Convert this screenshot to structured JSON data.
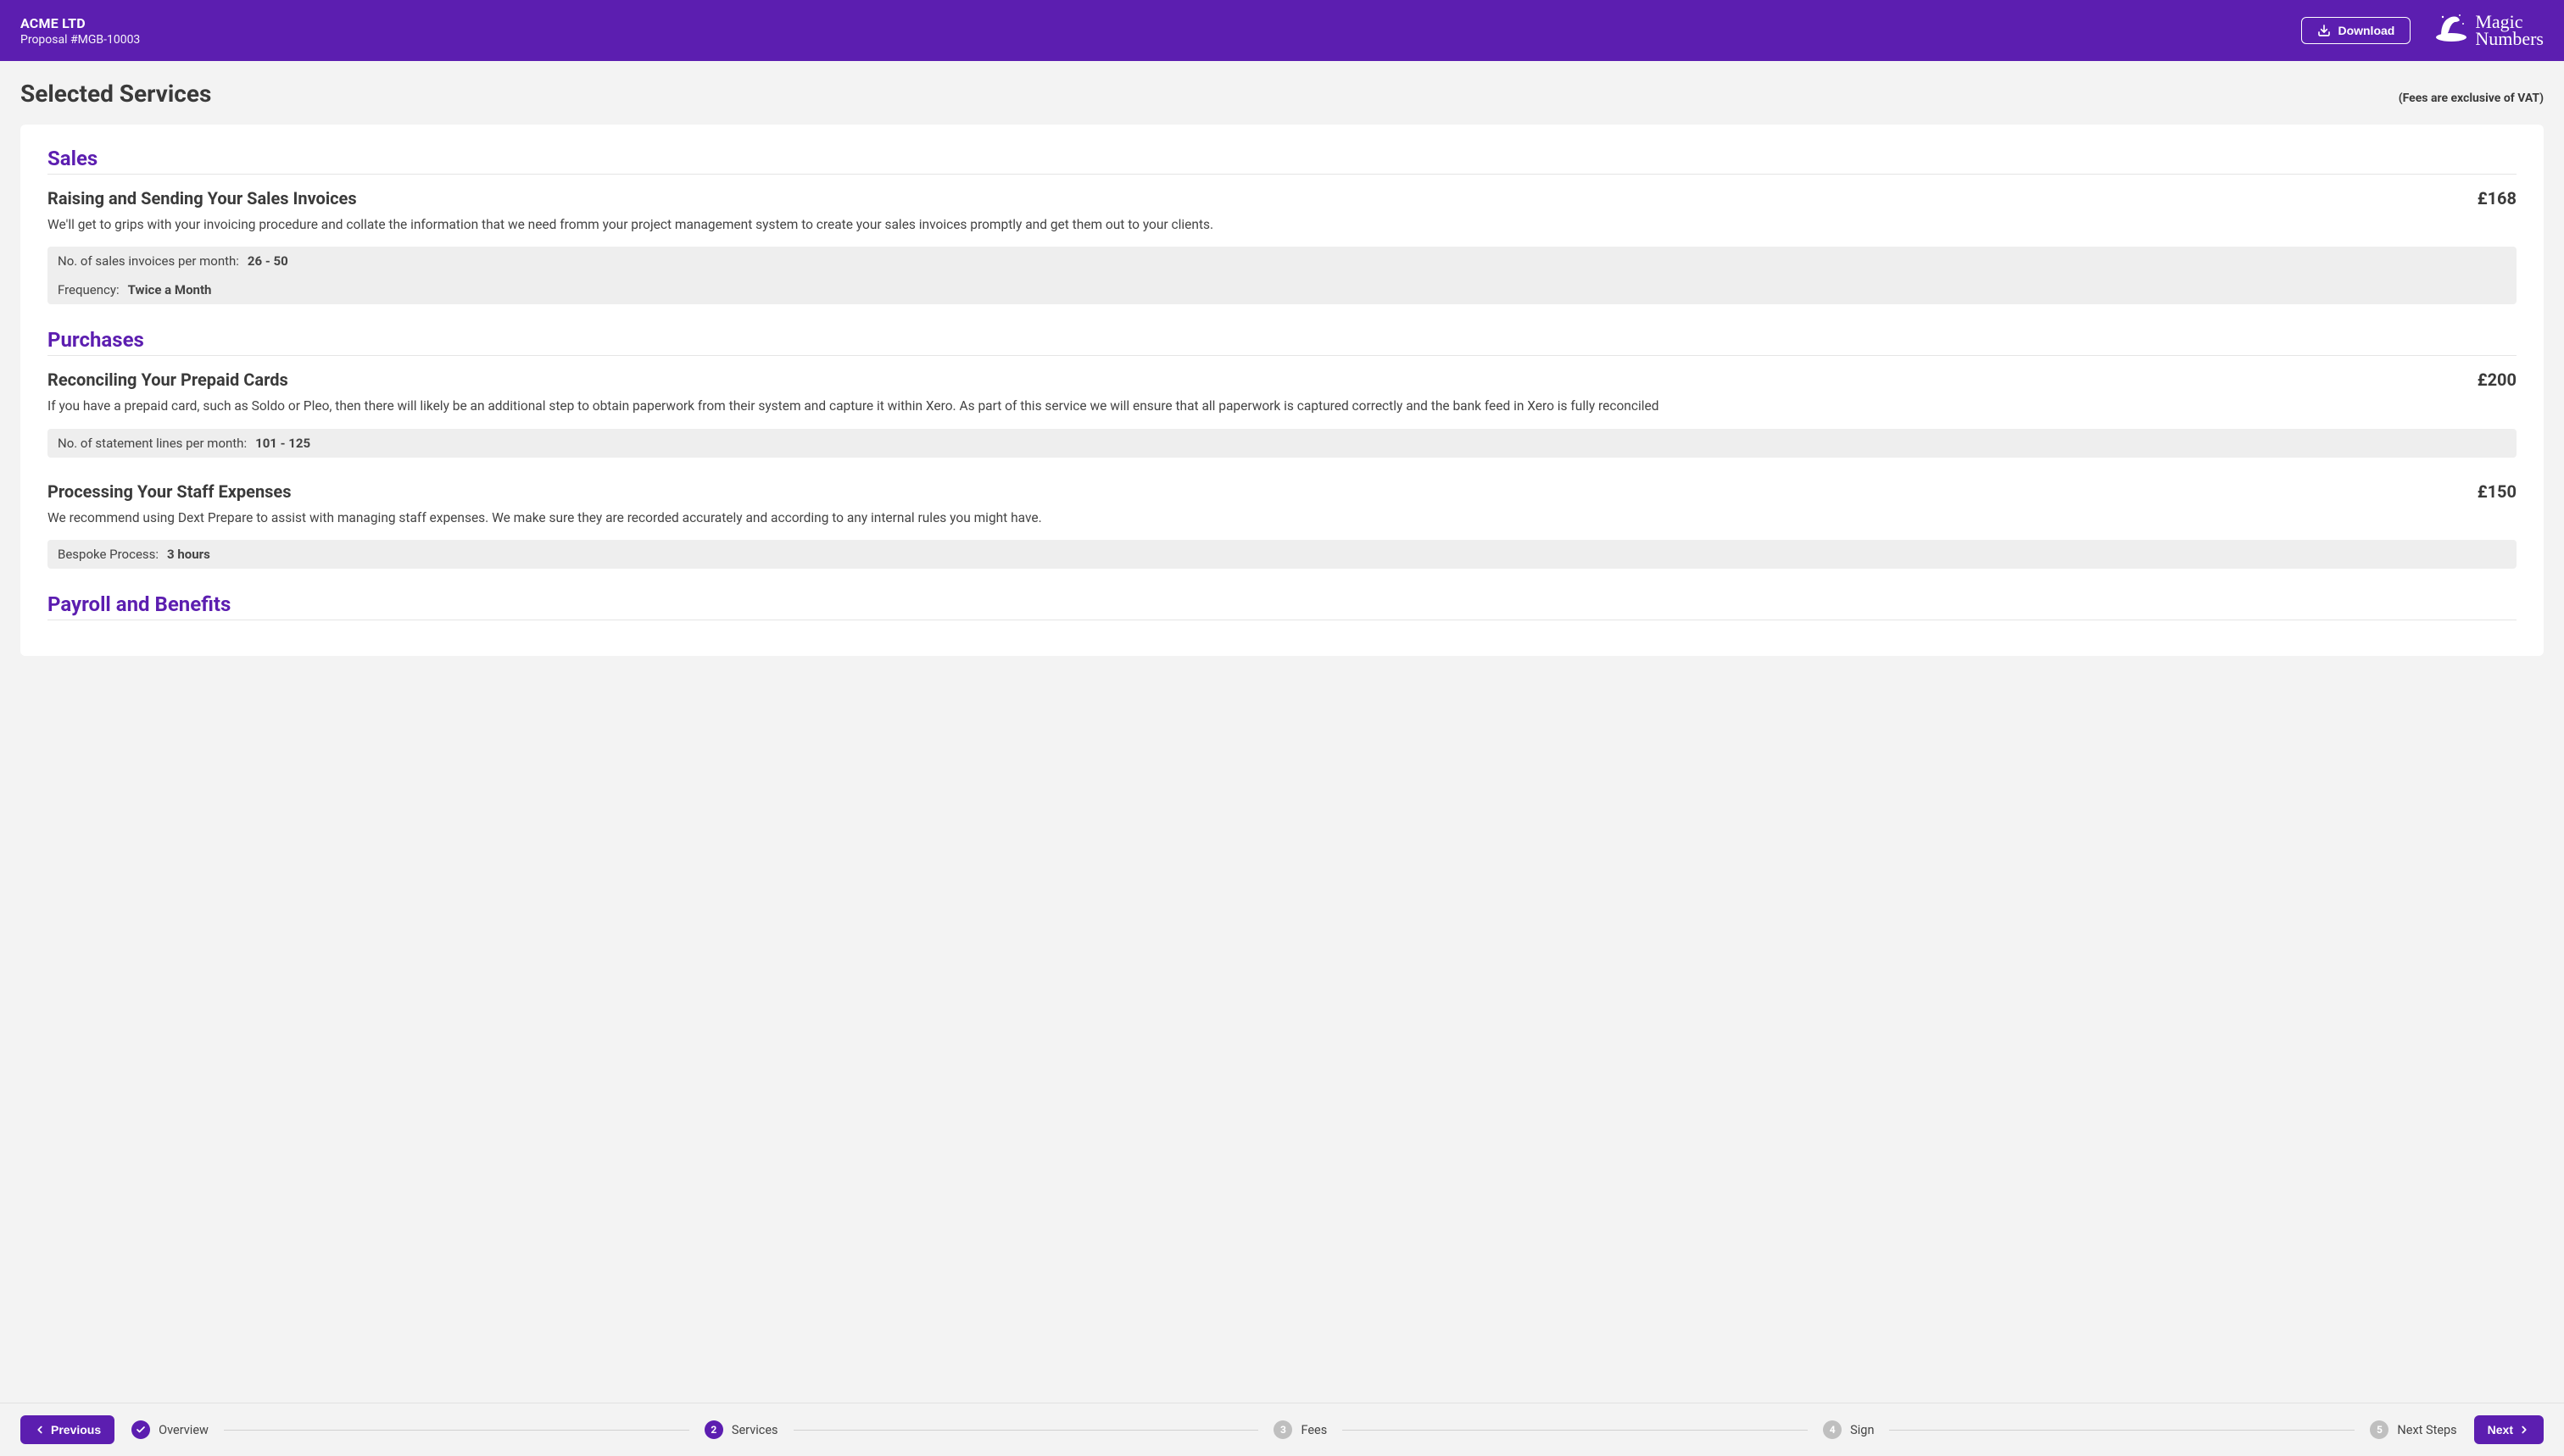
{
  "header": {
    "company": "ACME LTD",
    "proposal": "Proposal #MGB-10003",
    "download_label": "Download",
    "logo": {
      "line1": "Magic",
      "line2": "Numbers"
    }
  },
  "page": {
    "title": "Selected Services",
    "vat_note": "(Fees are exclusive of VAT)"
  },
  "categories": [
    {
      "name": "Sales",
      "services": [
        {
          "name": "Raising and Sending Your Sales Invoices",
          "price": "£168",
          "desc": "We'll get to grips with your invoicing procedure and collate the information that we need fromm your project management system to create your sales invoices promptly and get them out to your clients.",
          "params": [
            {
              "label": "No. of sales invoices per month:",
              "value": "26 - 50"
            },
            {
              "label": "Frequency:",
              "value": "Twice a Month"
            }
          ]
        }
      ]
    },
    {
      "name": "Purchases",
      "services": [
        {
          "name": "Reconciling Your Prepaid Cards",
          "price": "£200",
          "desc": "If you have a prepaid card, such as Soldo or Pleo, then there will likely be an additional step to obtain paperwork from their system and capture it within Xero. As part of this service we will ensure that all paperwork is captured correctly and the bank feed in Xero is fully reconciled",
          "params": [
            {
              "label": "No. of statement lines per month:",
              "value": "101 - 125"
            }
          ]
        },
        {
          "name": "Processing Your Staff Expenses",
          "price": "£150",
          "desc": "We recommend using Dext Prepare to assist with managing staff expenses. We make sure they are recorded accurately and according to any internal rules you might have.",
          "params": [
            {
              "label": "Bespoke Process:",
              "value": "3 hours"
            }
          ]
        }
      ]
    },
    {
      "name": "Payroll and Benefits",
      "services": []
    }
  ],
  "footer": {
    "previous_label": "Previous",
    "next_label": "Next",
    "steps": [
      {
        "label": "Overview",
        "state": "done"
      },
      {
        "label": "Services",
        "state": "active",
        "num": "2"
      },
      {
        "label": "Fees",
        "state": "pending",
        "num": "3"
      },
      {
        "label": "Sign",
        "state": "pending",
        "num": "4"
      },
      {
        "label": "Next Steps",
        "state": "pending",
        "num": "5"
      }
    ]
  }
}
